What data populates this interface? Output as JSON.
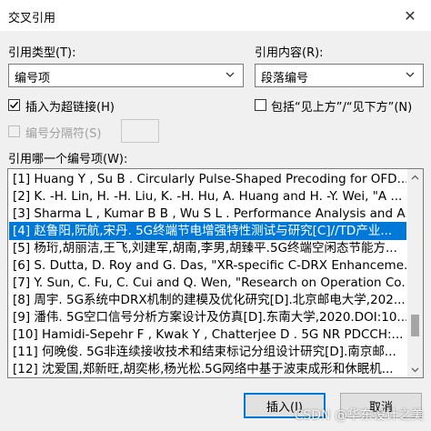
{
  "window": {
    "title": "交叉引用",
    "close_glyph": "✕"
  },
  "reference_type": {
    "label": "引用类型(T):",
    "value": "编号项"
  },
  "insert_reference_to": {
    "label": "引用内容(R):",
    "value": "段落编号"
  },
  "insert_as_hyperlink": {
    "label": "插入为超链接(H)",
    "checked": true
  },
  "include_above_below": {
    "label": "包括“见上方”/“见下方”(N)",
    "checked": false
  },
  "separate_numbers": {
    "label": "编号分隔符(S)",
    "checked": false,
    "enabled": false
  },
  "list": {
    "label": "引用哪一个编号项(W):",
    "selected_index": 3,
    "items": [
      "[1] Huang Y , Su B . Circularly Pulse-Shaped Precoding for OFD...",
      "[2] K. -H. Lin, H. -H. Liu, K. -H. Hu, A. Huang and H. -Y. Wei, \"A ...",
      "[3] Sharma L , Kumar B B , Wu S L . Performance Analysis and A...",
      "[4] 赵鲁阳,阮航,宋丹. 5G终端节电增强特性测试与研究[C]//TD产业...",
      "[5] 杨珩,胡丽洁,王飞,刘建军,胡南,李男,胡臻平.5G终端空闲态节能方...",
      "[6] S. Dutta, D. Roy and G. Das, \"XR-specific C-DRX Enhanceme...",
      "[7] Y. Sun, C. Fu, C. Cui and Q. Wen, \"Research on Operation Co...",
      "[8] 周宇. 5G系统中DRX机制的建模及优化研究[D].北京邮电大学,202...",
      "[9] 潘伟. 5G空口信号分析方案设计及仿真[D].东南大学,2020.DOI:10...",
      "[10] Hamidi-Sepehr F , Kwak Y , Chatterjee D . 5G NR PDCCH:...",
      "[11] 何晚俊. 5G非连续接收技术和结束标记分组设计研究[D].南京邮...",
      "[12] 沈爱国,郑新旺,胡奕彬,杨光松.5G网络中基于波束成形和休眠机..."
    ]
  },
  "buttons": {
    "insert": "插入(I)",
    "cancel": "取消"
  },
  "watermark": "CSDN @华东设计之美",
  "colors": {
    "selection": "#0078d7",
    "default_button_border": "#0078d7"
  }
}
